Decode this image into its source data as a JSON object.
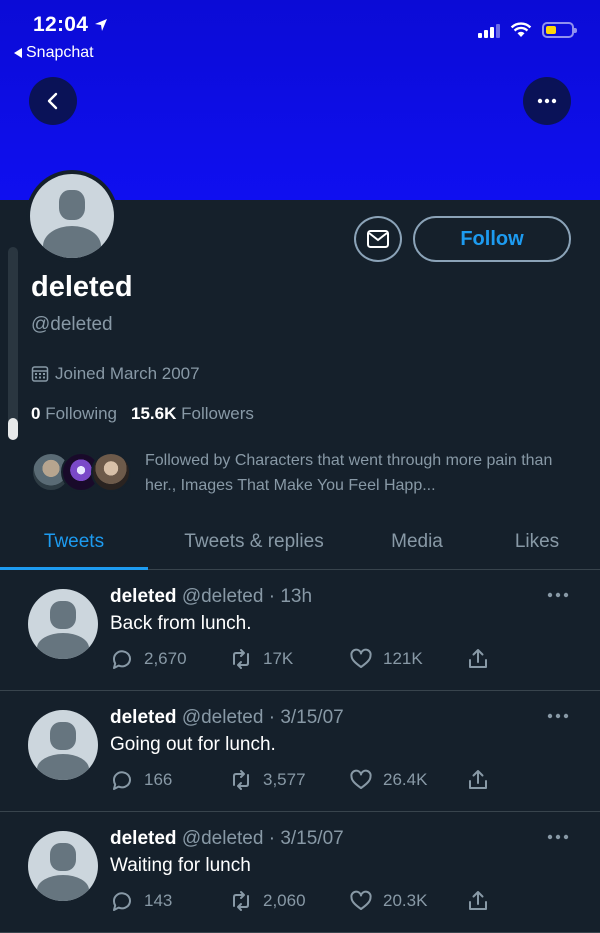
{
  "status_bar": {
    "time": "12:04",
    "back_app": "Snapchat"
  },
  "profile": {
    "display_name": "deleted",
    "handle": "@deleted",
    "joined": "Joined March 2007",
    "following_count": "0",
    "following_label": "Following",
    "followers_count": "15.6K",
    "followers_label": "Followers",
    "followed_by": "Followed by Characters that went through more pain than her., Images That Make You Feel Happ...",
    "follow_button": "Follow"
  },
  "tabs": [
    {
      "label": "Tweets",
      "active": true
    },
    {
      "label": "Tweets & replies",
      "active": false
    },
    {
      "label": "Media",
      "active": false
    },
    {
      "label": "Likes",
      "active": false
    }
  ],
  "tweets": [
    {
      "name": "deleted",
      "meta": "@deleted · 13h",
      "text": "Back from lunch.",
      "replies": "2,670",
      "retweets": "17K",
      "likes": "121K"
    },
    {
      "name": "deleted",
      "meta": "@deleted · 3/15/07",
      "text": "Going out for lunch.",
      "replies": "166",
      "retweets": "3,577",
      "likes": "26.4K"
    },
    {
      "name": "deleted",
      "meta": "@deleted · 3/15/07",
      "text": "Waiting for lunch",
      "replies": "143",
      "retweets": "2,060",
      "likes": "20.3K"
    }
  ],
  "colors": {
    "accent": "#1d9bf0",
    "banner": "#0f0ff0",
    "background": "#15202b",
    "muted": "#8899a6"
  }
}
